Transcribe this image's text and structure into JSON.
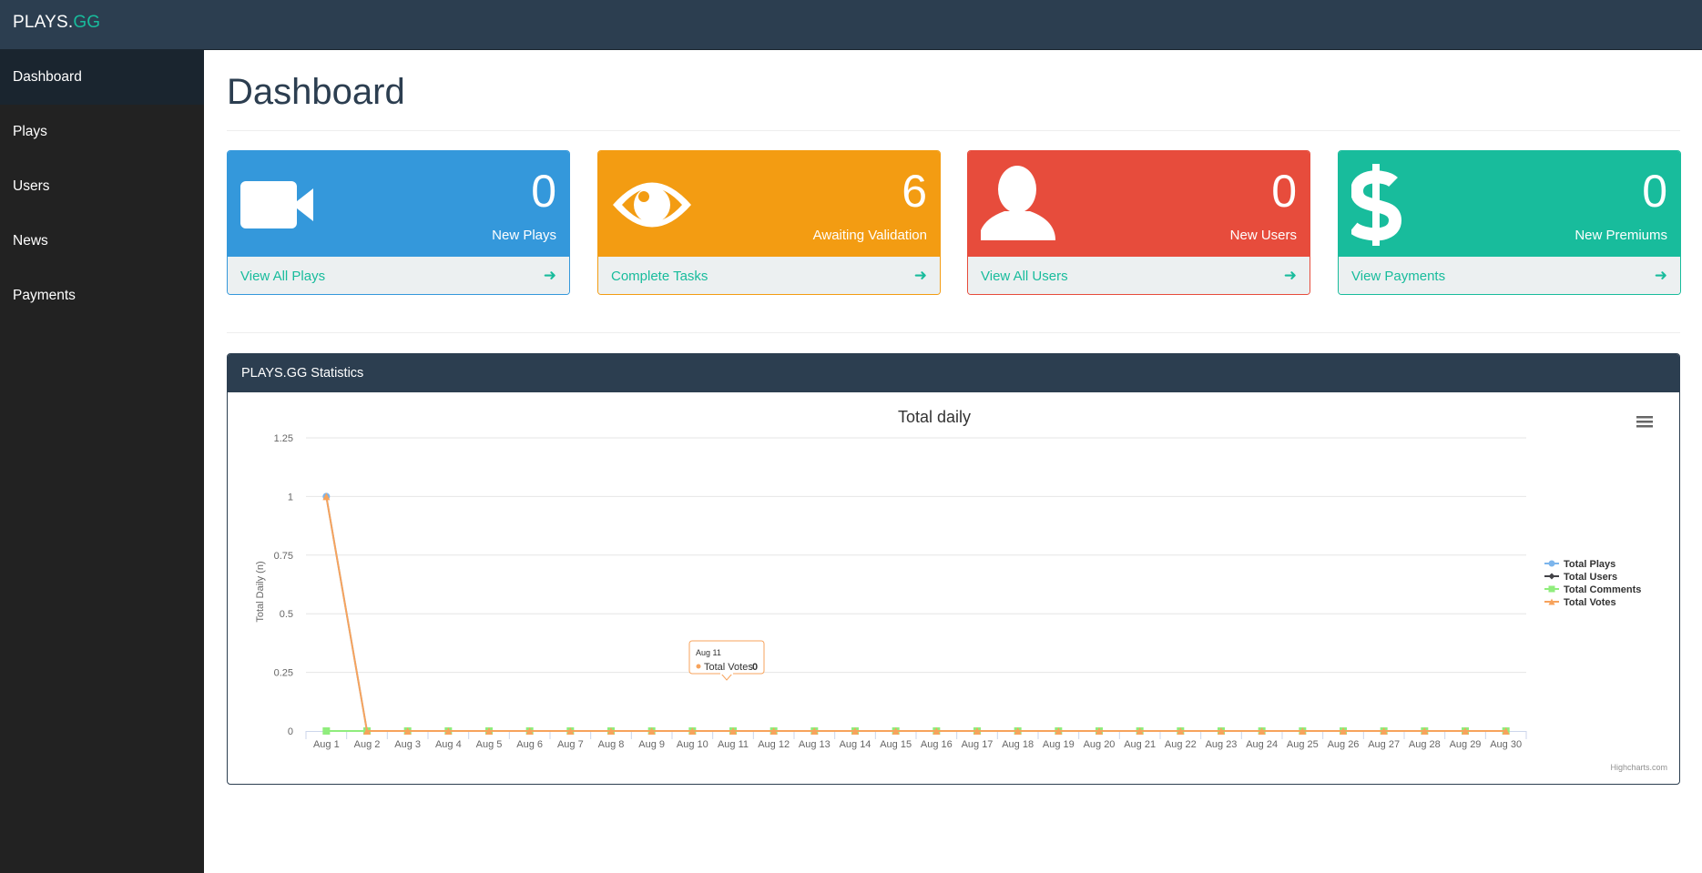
{
  "brand": {
    "main": "PLAYS.",
    "accent": "GG"
  },
  "sidebar": {
    "items": [
      {
        "label": "Dashboard",
        "active": true
      },
      {
        "label": "Plays"
      },
      {
        "label": "Users"
      },
      {
        "label": "News"
      },
      {
        "label": "Payments"
      }
    ]
  },
  "page": {
    "title": "Dashboard"
  },
  "panels": [
    {
      "count": "0",
      "desc": "New Plays",
      "link": "View All Plays",
      "icon": "video-camera-icon",
      "color": "#3498db"
    },
    {
      "count": "6",
      "desc": "Awaiting Validation",
      "link": "Complete Tasks",
      "icon": "eye-icon",
      "color": "#f39c12"
    },
    {
      "count": "0",
      "desc": "New Users",
      "link": "View All Users",
      "icon": "user-icon",
      "color": "#e74c3c"
    },
    {
      "count": "0",
      "desc": "New Premiums",
      "link": "View Payments",
      "icon": "dollar-icon",
      "color": "#18bc9c"
    }
  ],
  "arrow_glyph": "➜",
  "stats": {
    "header": "PLAYS.GG Statistics",
    "credits": "Highcharts.com"
  },
  "tooltip": {
    "date": "Aug 11",
    "series": "Total Votes",
    "value": "0"
  },
  "colors": {
    "primary": "#2c3e50",
    "accent": "#18bc9c",
    "sidebar": "#222222"
  },
  "chart_data": {
    "type": "line",
    "title": "Total daily",
    "ylabel": "Total Daily (n)",
    "ylim": [
      0,
      1.25
    ],
    "yticks": [
      "0",
      "0.25",
      "0.5",
      "0.75",
      "1",
      "1.25"
    ],
    "legend_position": "right",
    "categories": [
      "Aug 1",
      "Aug 2",
      "Aug 3",
      "Aug 4",
      "Aug 5",
      "Aug 6",
      "Aug 7",
      "Aug 8",
      "Aug 9",
      "Aug 10",
      "Aug 11",
      "Aug 12",
      "Aug 13",
      "Aug 14",
      "Aug 15",
      "Aug 16",
      "Aug 17",
      "Aug 18",
      "Aug 19",
      "Aug 20",
      "Aug 21",
      "Aug 22",
      "Aug 23",
      "Aug 24",
      "Aug 25",
      "Aug 26",
      "Aug 27",
      "Aug 28",
      "Aug 29",
      "Aug 30"
    ],
    "series": [
      {
        "name": "Total Plays",
        "color": "#7cb5ec",
        "marker": "circle",
        "values": [
          1,
          0,
          0,
          0,
          0,
          0,
          0,
          0,
          0,
          0,
          0,
          0,
          0,
          0,
          0,
          0,
          0,
          0,
          0,
          0,
          0,
          0,
          0,
          0,
          0,
          0,
          0,
          0,
          0,
          0
        ]
      },
      {
        "name": "Total Users",
        "color": "#434348",
        "marker": "diamond",
        "values": [
          0,
          0,
          0,
          0,
          0,
          0,
          0,
          0,
          0,
          0,
          0,
          0,
          0,
          0,
          0,
          0,
          0,
          0,
          0,
          0,
          0,
          0,
          0,
          0,
          0,
          0,
          0,
          0,
          0,
          0
        ]
      },
      {
        "name": "Total Comments",
        "color": "#90ed7d",
        "marker": "square",
        "values": [
          0,
          0,
          0,
          0,
          0,
          0,
          0,
          0,
          0,
          0,
          0,
          0,
          0,
          0,
          0,
          0,
          0,
          0,
          0,
          0,
          0,
          0,
          0,
          0,
          0,
          0,
          0,
          0,
          0,
          0
        ]
      },
      {
        "name": "Total Votes",
        "color": "#f7a35c",
        "marker": "triangle",
        "values": [
          1,
          0,
          0,
          0,
          0,
          0,
          0,
          0,
          0,
          0,
          0,
          0,
          0,
          0,
          0,
          0,
          0,
          0,
          0,
          0,
          0,
          0,
          0,
          0,
          0,
          0,
          0,
          0,
          0,
          0
        ]
      }
    ]
  }
}
